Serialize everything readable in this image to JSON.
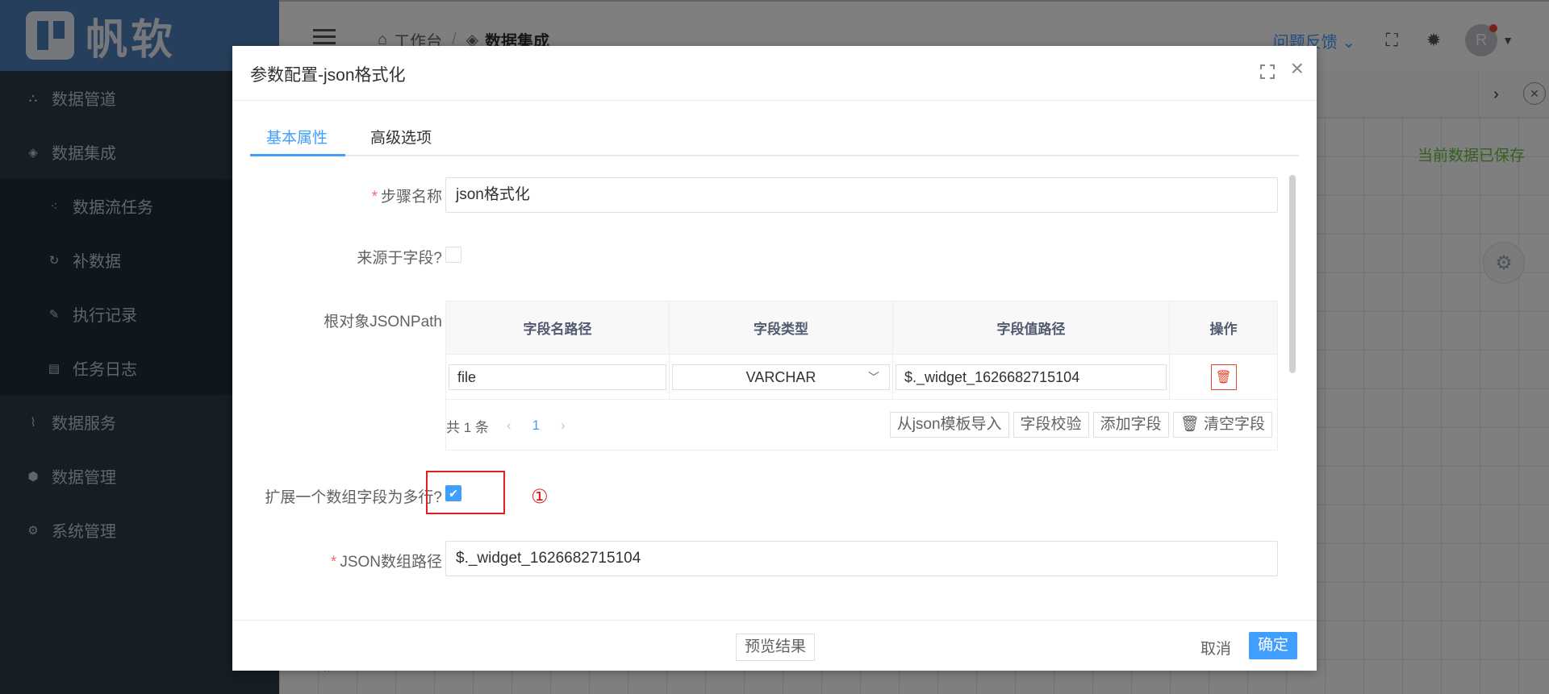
{
  "brand": {
    "name": "帆软"
  },
  "sidebar": {
    "items": [
      {
        "label": "数据管道",
        "icon": "pipeline-icon"
      },
      {
        "label": "数据集成",
        "icon": "layers-icon"
      },
      {
        "label": "数据流任务",
        "icon": "flow-icon"
      },
      {
        "label": "补数据",
        "icon": "refresh-icon"
      },
      {
        "label": "执行记录",
        "icon": "pen-icon"
      },
      {
        "label": "任务日志",
        "icon": "file-icon"
      },
      {
        "label": "数据服务",
        "icon": "pulse-icon"
      },
      {
        "label": "数据管理",
        "icon": "cube-icon"
      },
      {
        "label": "系统管理",
        "icon": "gear-icon"
      }
    ]
  },
  "header": {
    "breadcrumb": [
      "工作台",
      "数据集成"
    ],
    "breadcrumb_sep": "/",
    "feedback": "问题反馈",
    "avatar_initial": "R"
  },
  "background": {
    "saved_status": "当前数据已保存"
  },
  "dialog": {
    "title": "参数配置-json格式化",
    "tabs": [
      "基本属性",
      "高级选项"
    ],
    "fields": {
      "step_name_label": "步骤名称",
      "step_name_value": "json格式化",
      "from_field_label": "来源于字段?",
      "from_field_checked": false,
      "root_jsonpath_label": "根对象JSONPath",
      "expand_label": "扩展一个数组字段为多行?",
      "expand_checked": true,
      "json_array_path_label": "JSON数组路径",
      "json_array_path_value": "$._widget_1626682715104"
    },
    "table": {
      "columns": [
        "字段名路径",
        "字段类型",
        "字段值路径",
        "操作"
      ],
      "rows": [
        {
          "name_path": "file",
          "type": "VARCHAR",
          "value_path": "$._widget_1626682715104"
        }
      ],
      "total": "共 1 条",
      "page": "1",
      "buttons": [
        "从json模板导入",
        "字段校验",
        "添加字段",
        "清空字段"
      ]
    },
    "annotation": "①",
    "footer": {
      "preview": "预览结果",
      "cancel": "取消",
      "ok": "确定"
    }
  },
  "colors": {
    "primary": "#409eff",
    "sidebar_bg": "#2b3a4a",
    "logo_bg": "#4d7fb8",
    "danger": "#e6492d",
    "success": "#67c23a"
  }
}
